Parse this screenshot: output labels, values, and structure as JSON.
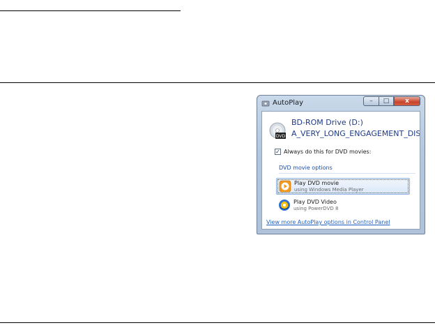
{
  "window": {
    "title": "AutoPlay",
    "controls": {
      "minimize": "–",
      "maximize": "□",
      "close": "x"
    }
  },
  "drive": {
    "name": "BD-ROM Drive (D:)",
    "label": "A_VERY_LONG_ENGAGEMENT_DISC",
    "icon": "dvd-drive-icon"
  },
  "always_checkbox": {
    "label": "Always do this for DVD movies:",
    "checked": true,
    "check_glyph": "✓"
  },
  "section": {
    "title": "DVD movie options"
  },
  "options": [
    {
      "title": "Play DVD movie",
      "subtitle": "using Windows Media Player",
      "icon": "windows-media-player-icon",
      "selected": true
    },
    {
      "title": "Play DVD Video",
      "subtitle": "using PowerDVD 8",
      "icon": "powerdvd-icon",
      "selected": false
    }
  ],
  "more_link": "View more AutoPlay options in Control Panel",
  "colors": {
    "link": "#1f5fbf",
    "heading": "#1e3a8a",
    "close": "#c7442a",
    "titlebar": "#b3c7de"
  }
}
